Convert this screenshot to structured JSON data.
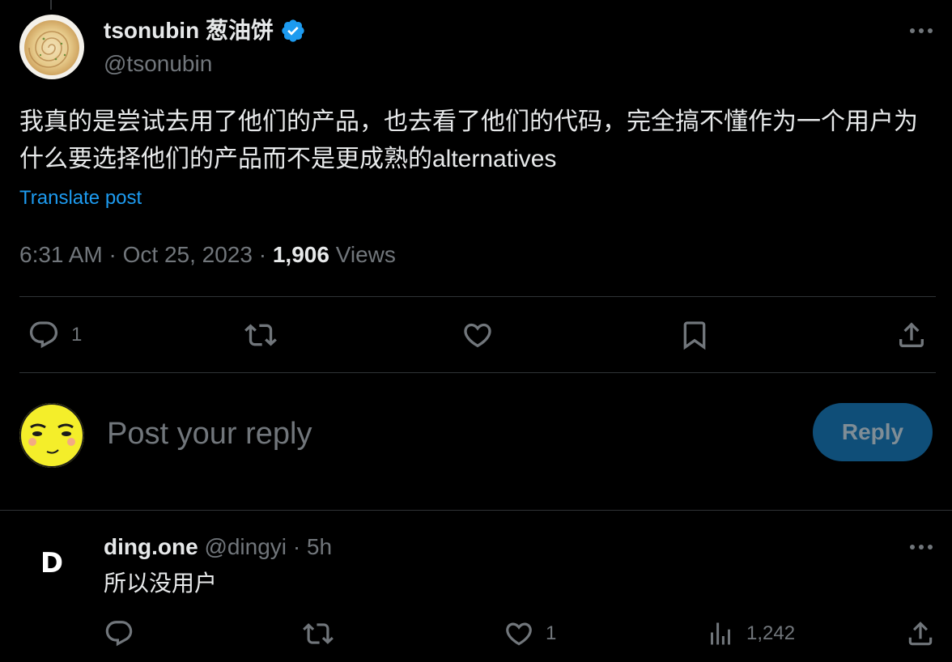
{
  "tweet": {
    "author_name": "tsonubin 葱油饼",
    "author_handle": "@tsonubin",
    "verified": true,
    "text": "我真的是尝试去用了他们的产品，也去看了他们的代码，完全搞不懂作为一个用户为什么要选择他们的产品而不是更成熟的alternatives",
    "translate_label": "Translate post",
    "time": "6:31 AM",
    "date": "Oct 25, 2023",
    "separator": "·",
    "views_count": "1,906",
    "views_label": "Views",
    "actions": {
      "reply_count": "1",
      "retweet_count": "",
      "like_count": "",
      "bookmark_count": ""
    }
  },
  "compose": {
    "placeholder": "Post your reply",
    "reply_button_label": "Reply"
  },
  "reply": {
    "author_name": "ding.one",
    "author_handle": "@dingyi",
    "separator": "·",
    "time_ago": "5h",
    "avatar_letter": "D",
    "text": "所以没用户",
    "actions": {
      "reply_count": "",
      "retweet_count": "",
      "like_count": "1",
      "views_count": "1,242"
    }
  },
  "colors": {
    "background": "#000000",
    "text_primary": "#e7e9ea",
    "text_secondary": "#71767b",
    "accent": "#1d9bf0",
    "divider": "#2f3336",
    "reply_button_bg": "#0f4e78"
  },
  "icons": {
    "verified": "verified-badge-icon",
    "more": "more-horizontal-icon",
    "reply": "reply-bubble-icon",
    "retweet": "retweet-icon",
    "like": "heart-icon",
    "bookmark": "bookmark-icon",
    "share": "share-upload-icon",
    "views": "analytics-bars-icon"
  }
}
